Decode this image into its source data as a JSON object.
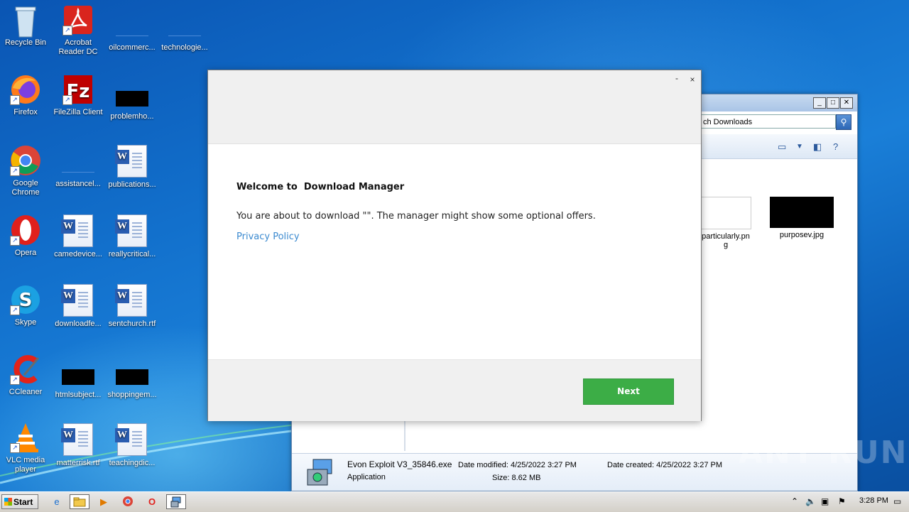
{
  "desktop": {
    "icons": [
      {
        "label": "Recycle Bin",
        "icon": "recycle-bin-icon"
      },
      {
        "label": "Acrobat Reader DC",
        "icon": "acrobat-icon"
      },
      {
        "label": "oilcommerc...",
        "icon": "file-icon"
      },
      {
        "label": "technologie...",
        "icon": "file-icon"
      },
      {
        "label": "Firefox",
        "icon": "firefox-icon"
      },
      {
        "label": "FileZilla Client",
        "icon": "filezilla-icon"
      },
      {
        "label": "problemho...",
        "icon": "file-icon"
      },
      {
        "label": "Google Chrome",
        "icon": "chrome-icon"
      },
      {
        "label": "assistancel...",
        "icon": "file-icon"
      },
      {
        "label": "publications...",
        "icon": "word-doc-icon"
      },
      {
        "label": "Opera",
        "icon": "opera-icon"
      },
      {
        "label": "camedevice...",
        "icon": "word-doc-icon"
      },
      {
        "label": "reallycritical...",
        "icon": "word-doc-icon"
      },
      {
        "label": "Skype",
        "icon": "skype-icon"
      },
      {
        "label": "downloadfe...",
        "icon": "word-doc-icon"
      },
      {
        "label": "sentchurch.rtf",
        "icon": "word-doc-icon"
      },
      {
        "label": "CCleaner",
        "icon": "ccleaner-icon"
      },
      {
        "label": "htmlsubject...",
        "icon": "file-icon"
      },
      {
        "label": "shoppingem...",
        "icon": "file-icon"
      },
      {
        "label": "VLC media player",
        "icon": "vlc-icon"
      },
      {
        "label": "matterrisk.rtf",
        "icon": "word-doc-icon"
      },
      {
        "label": "teachingdic...",
        "icon": "word-doc-icon"
      }
    ]
  },
  "explorer": {
    "search_value": "ch Downloads",
    "thumbnails": [
      {
        "label": "particularly.png"
      },
      {
        "label": "purposev.jpg"
      }
    ],
    "details": {
      "file_name": "Evon Exploit V3_35846.exe",
      "file_type": "Application",
      "date_modified": "Date modified: 4/25/2022 3:27 PM",
      "size": "Size: 8.62 MB",
      "date_created": "Date created: 4/25/2022 3:27 PM"
    }
  },
  "dialog": {
    "minimize_glyph": "-",
    "close_glyph": "×",
    "title": "Welcome to  Download Manager",
    "message": "You are about to download \"\". The manager might show some optional offers.",
    "privacy_link": "Privacy Policy",
    "next_label": "Next"
  },
  "watermark": "ANY RUN",
  "taskbar": {
    "start_label": "Start",
    "clock": "3:28 PM"
  }
}
